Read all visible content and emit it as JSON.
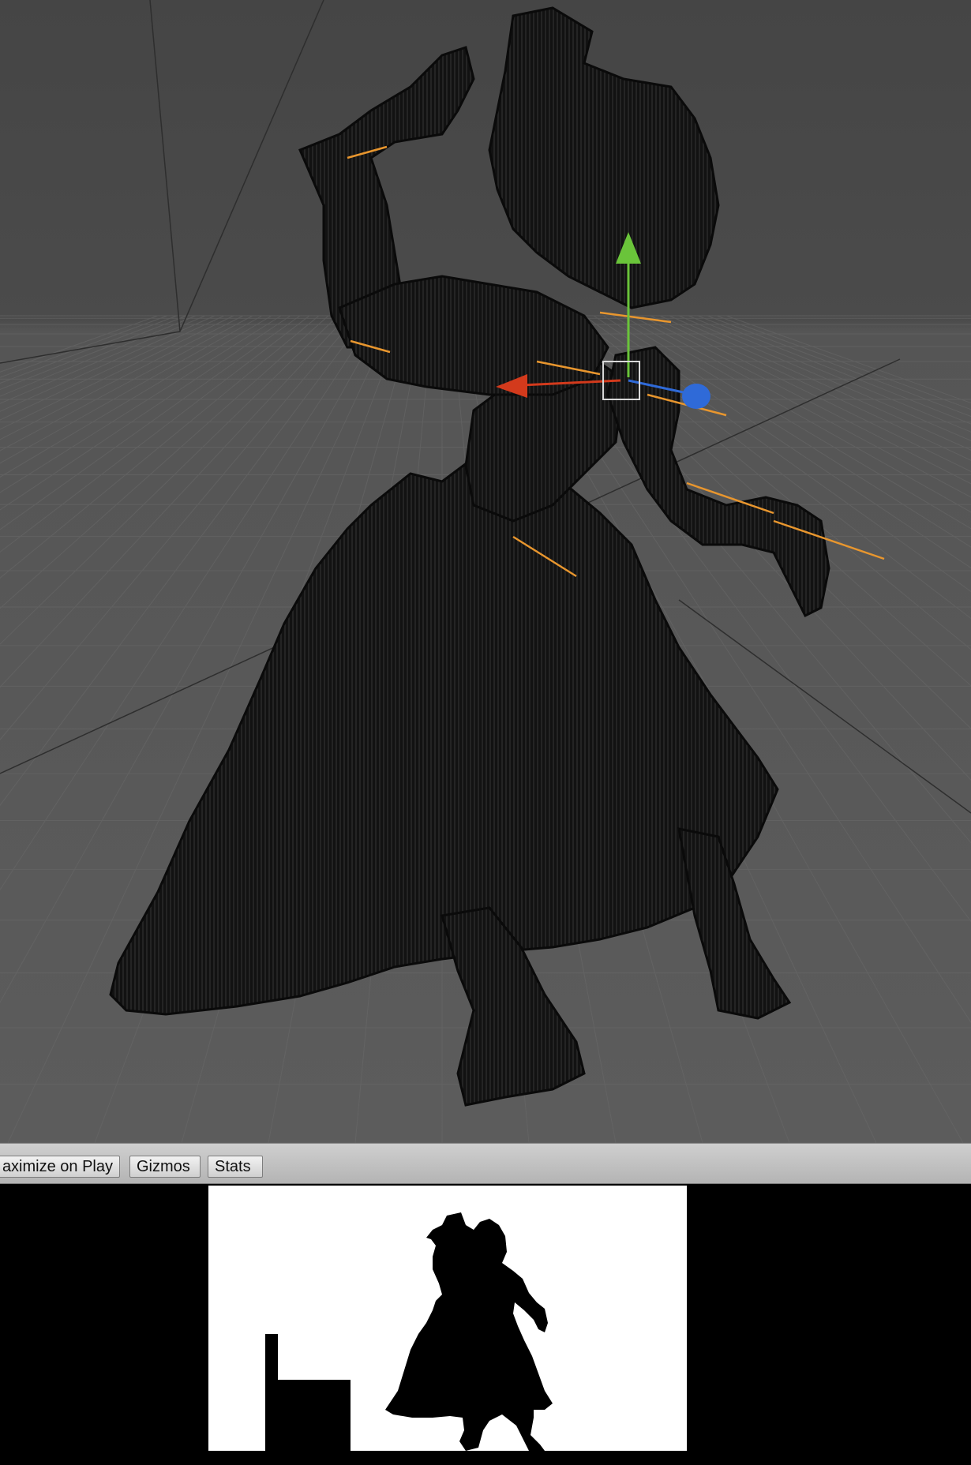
{
  "toolbar": {
    "maximize_on_play_label": "aximize on Play",
    "gizmos_label": "Gizmos",
    "stats_label": "Stats"
  },
  "scene": {
    "background_color": "#484848",
    "grid_color": "#5a5a5a",
    "mesh_color": "#151515",
    "bone_color": "#e8962e",
    "gizmo": {
      "x_axis_color": "#d33a1c",
      "y_axis_color": "#6ac43a",
      "z_axis_color": "#2f6ad8"
    }
  },
  "game_view": {
    "background_color": "#000000",
    "canvas_color": "#ffffff",
    "silhouette_color": "#000000"
  }
}
